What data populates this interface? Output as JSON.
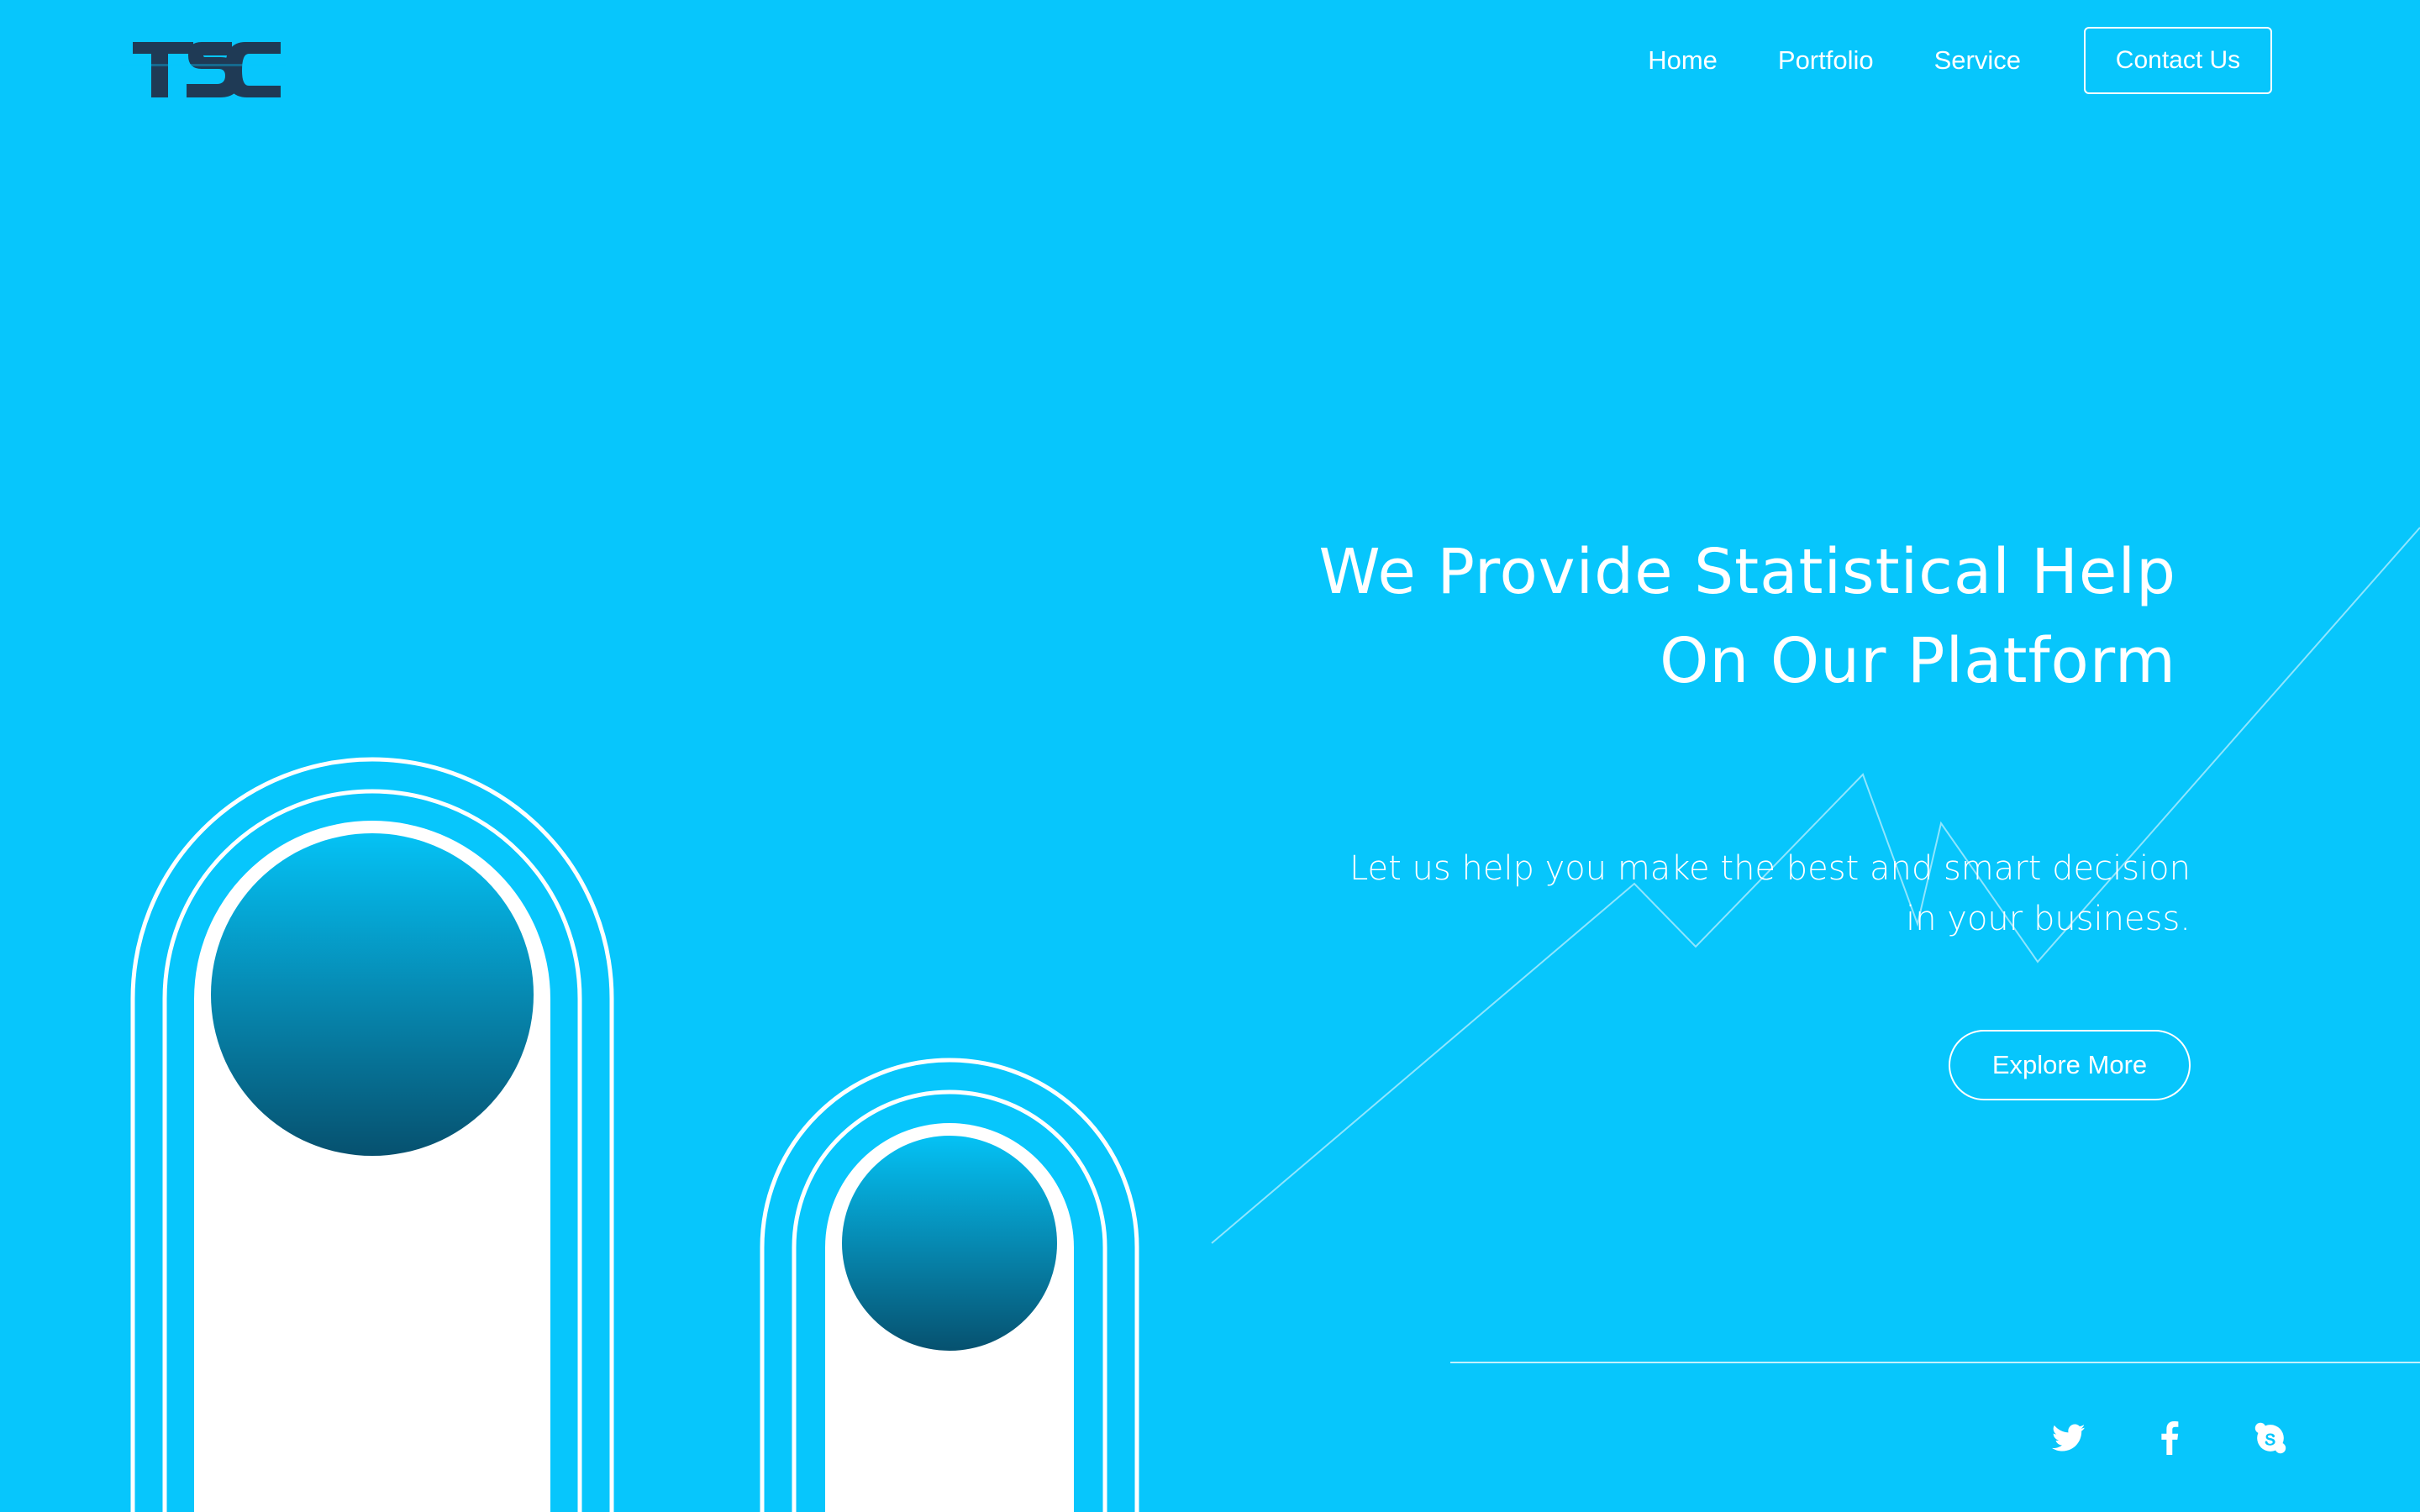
{
  "header": {
    "logo_text": "TSC",
    "nav": [
      {
        "label": "Home"
      },
      {
        "label": "Portfolio"
      },
      {
        "label": "Service"
      }
    ],
    "contact_label": "Contact Us"
  },
  "hero": {
    "title_line1": "We Provide Statistical Help",
    "title_line2": "On Our Platform",
    "subtitle_line1": "Let us help you make the best and smart decision",
    "subtitle_line2": "in your business.",
    "cta_label": "Explore More"
  },
  "social": {
    "icons": [
      "twitter-icon",
      "facebook-icon",
      "skype-icon"
    ]
  },
  "colors": {
    "background": "#07c6fc",
    "text": "#ffffff",
    "logo": "#1f3a55",
    "sphere_top": "#05c2f5",
    "sphere_bottom": "#06516f"
  }
}
